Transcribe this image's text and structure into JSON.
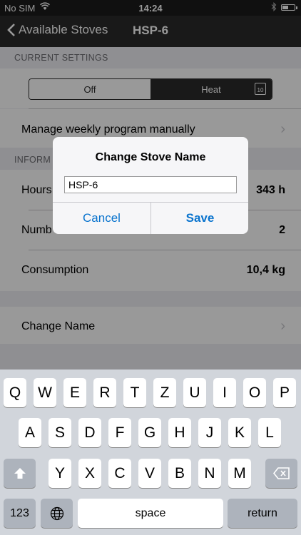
{
  "status_bar": {
    "carrier": "No SIM",
    "time": "14:24"
  },
  "nav": {
    "back_label": "Available Stoves",
    "title": "HSP-6"
  },
  "current_settings": {
    "header": "CURRENT SETTINGS",
    "segments": [
      "Off",
      "Heat"
    ],
    "calendar_day": "10",
    "manage_label": "Manage weekly program manually"
  },
  "information": {
    "header": "INFORM",
    "rows": [
      {
        "label": "Hours",
        "value": "343 h"
      },
      {
        "label": "Numb",
        "value": "2"
      },
      {
        "label": "Consumption",
        "value": "10,4 kg"
      }
    ]
  },
  "change_name_label": "Change Name",
  "alert": {
    "title": "Change Stove Name",
    "field_value": "HSP-6",
    "cancel_label": "Cancel",
    "save_label": "Save"
  },
  "keyboard": {
    "row1": [
      "Q",
      "W",
      "E",
      "R",
      "T",
      "Z",
      "U",
      "I",
      "O",
      "P"
    ],
    "row2": [
      "A",
      "S",
      "D",
      "F",
      "G",
      "H",
      "J",
      "K",
      "L"
    ],
    "row3": [
      "Y",
      "X",
      "C",
      "V",
      "B",
      "N",
      "M"
    ],
    "numbers_label": "123",
    "space_label": "space",
    "return_label": "return"
  },
  "colors": {
    "accent": "#0a74ce",
    "nav_bg": "#2b2b2b"
  }
}
